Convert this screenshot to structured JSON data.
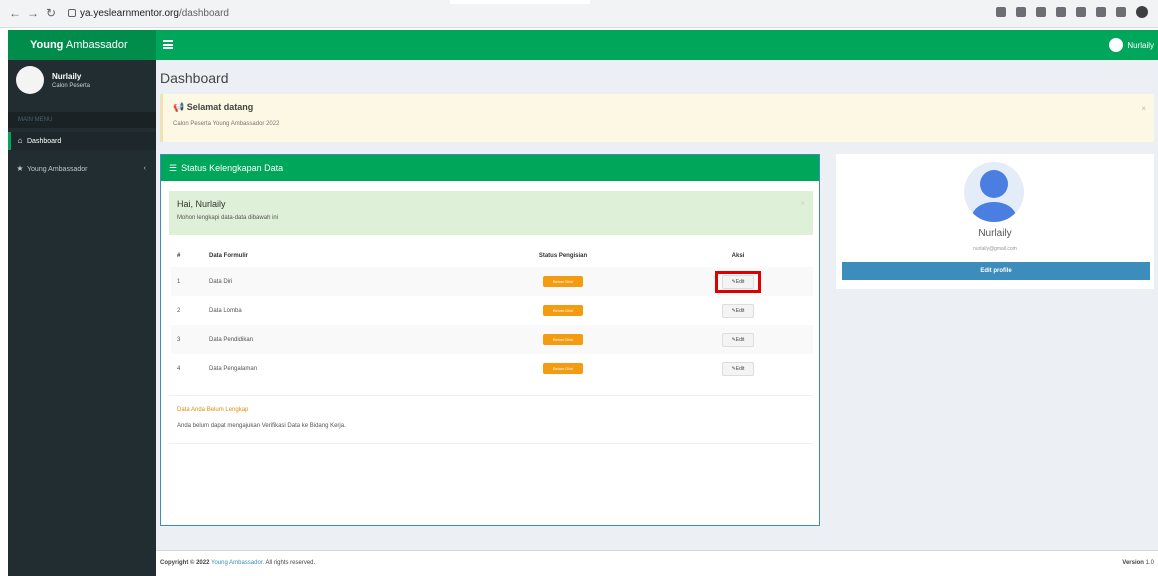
{
  "browser": {
    "url_host": "ya.yeslearnmentor.org",
    "url_path": "/dashboard"
  },
  "app": {
    "logo_bold": "Young",
    "logo_rest": " Ambassador"
  },
  "header": {
    "user_name": "Nurlaily"
  },
  "sidebar": {
    "user_name": "Nurlaily",
    "user_status": "Calon Peserta",
    "section_header": "MAIN MENU",
    "items": [
      {
        "label": "Dashboard",
        "icon": "dashboard-icon"
      },
      {
        "label": "Young Ambassador",
        "icon": "star-icon"
      }
    ]
  },
  "page": {
    "title": "Dashboard",
    "welcome_title": "Selamat datang",
    "welcome_subtitle": "Calon Peserta Young Ambassador 2022",
    "status_box_title": "Status Kelengkapan Data",
    "greeting_title": "Hai, Nurlaily",
    "greeting_subtitle": "Mohon lengkapi data-data dibawah ini",
    "table_headers": {
      "no": "#",
      "data": "Data Formulir",
      "status": "Status Pengisian",
      "aksi": "Aksi"
    },
    "rows": [
      {
        "no": "1",
        "data": "Data Diri",
        "status": "Belum Diisi",
        "action": "Edit"
      },
      {
        "no": "2",
        "data": "Data Lomba",
        "status": "Belum Diisi",
        "action": "Edit"
      },
      {
        "no": "3",
        "data": "Data Pendidikan",
        "status": "Belum Diisi",
        "action": "Edit"
      },
      {
        "no": "4",
        "data": "Data Pengalaman",
        "status": "Belum Diisi",
        "action": "Edit"
      }
    ],
    "note_title": "Data Anda Belum Lengkap",
    "note_body": "Anda belum dapat mengajukan Verifikasi Data ke Bidang Kerja."
  },
  "profile": {
    "name": "Nurlaily",
    "email": "nurlaily@gmail.com",
    "edit_label": "Edit profile"
  },
  "footer": {
    "copyright_bold": "Copyright © 2022",
    "brand": "Young Ambassador.",
    "rights": " All rights reserved.",
    "version_bold": "Version",
    "version": " 1.0"
  },
  "colors": {
    "header_green": "#00a65a",
    "sidebar_dark": "#222d32",
    "badge_orange": "#f39c12",
    "button_blue": "#3c8dbc",
    "highlight_red": "#dd0000"
  }
}
